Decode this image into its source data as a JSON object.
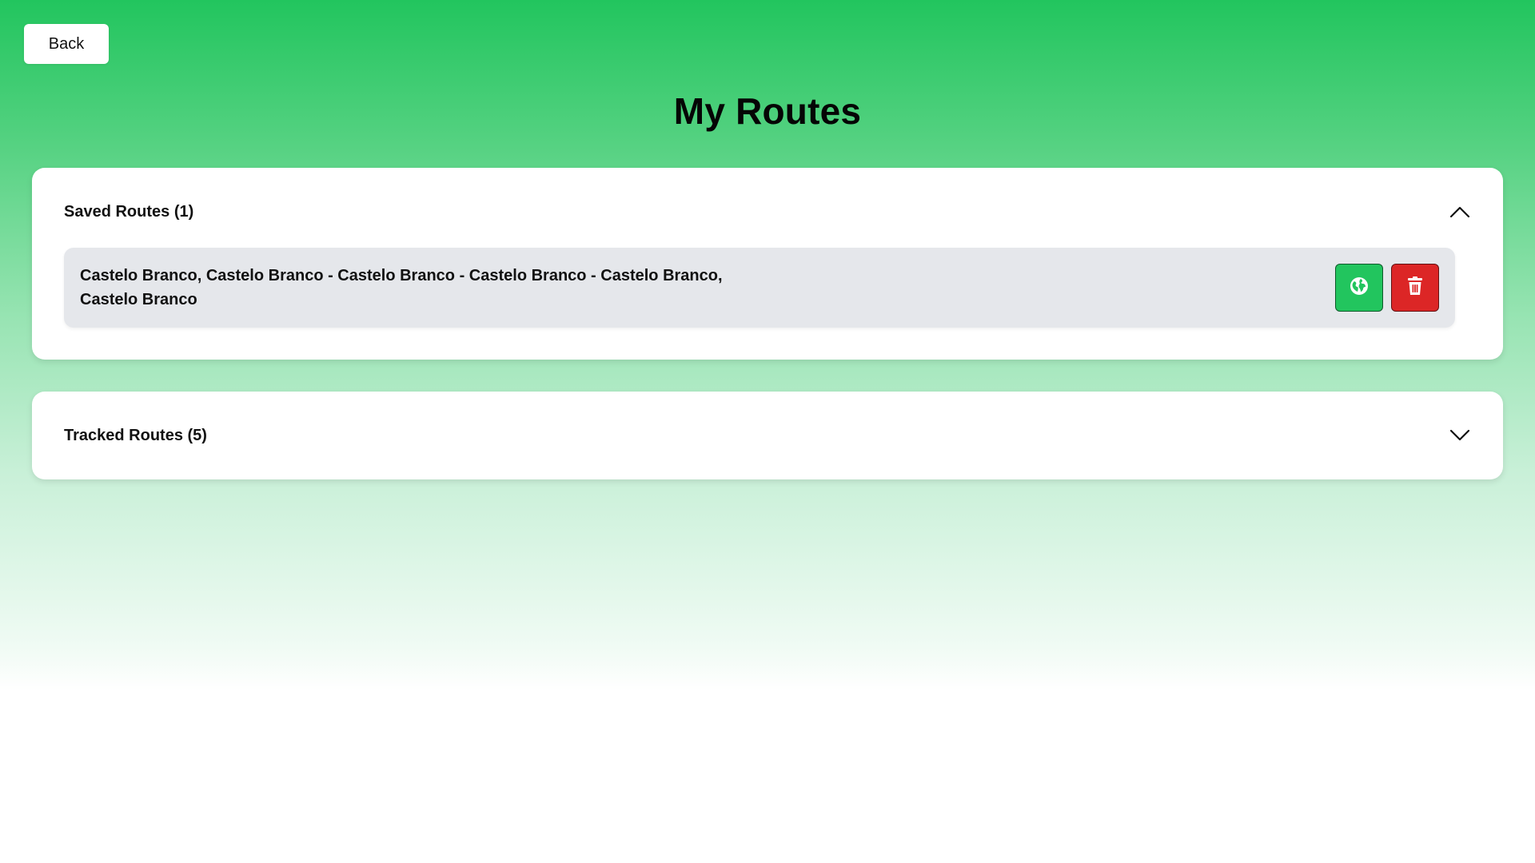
{
  "back_label": "Back",
  "page_title": "My Routes",
  "saved": {
    "title": "Saved Routes (1)",
    "expanded": true,
    "routes": [
      {
        "text": "Castelo Branco, Castelo Branco - Castelo Branco - Castelo Branco - Castelo Branco, Castelo Branco",
        "actions": {
          "view_icon": "globe-icon",
          "delete_icon": "trash-icon"
        }
      }
    ]
  },
  "tracked": {
    "title": "Tracked Routes (5)",
    "expanded": false
  },
  "colors": {
    "gradient_top": "#22c55e",
    "view_button": "#22c55e",
    "delete_button": "#dc2626",
    "route_item_bg": "#e5e7eb"
  }
}
